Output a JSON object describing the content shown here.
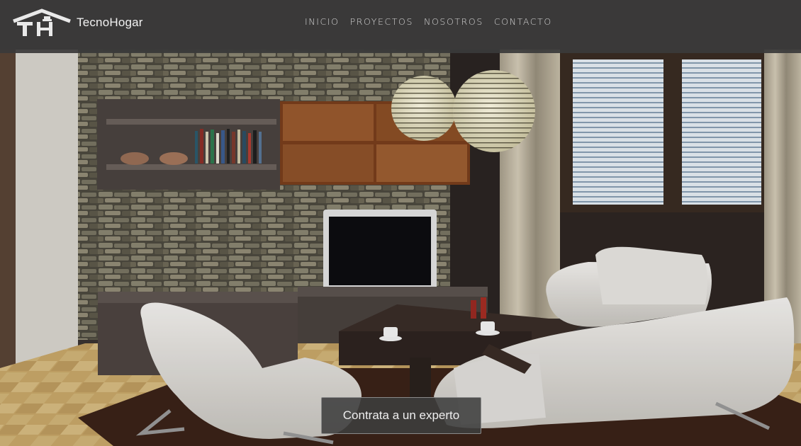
{
  "brand": {
    "name": "TecnoHogar",
    "logo_icon": "house-logo-icon"
  },
  "nav": {
    "items": [
      {
        "label": "INICIO"
      },
      {
        "label": "PROYECTOS"
      },
      {
        "label": "NOSOTROS"
      },
      {
        "label": "CONTACTO"
      }
    ]
  },
  "hero": {
    "image": "living-room-interior",
    "cta_label": "Contrata a un experto"
  },
  "colors": {
    "navbar_bg": "#3a3a3a",
    "nav_text": "#d8d8d8",
    "cta_bg": "#3e3e3e",
    "cta_border": "#8a8a8a"
  }
}
